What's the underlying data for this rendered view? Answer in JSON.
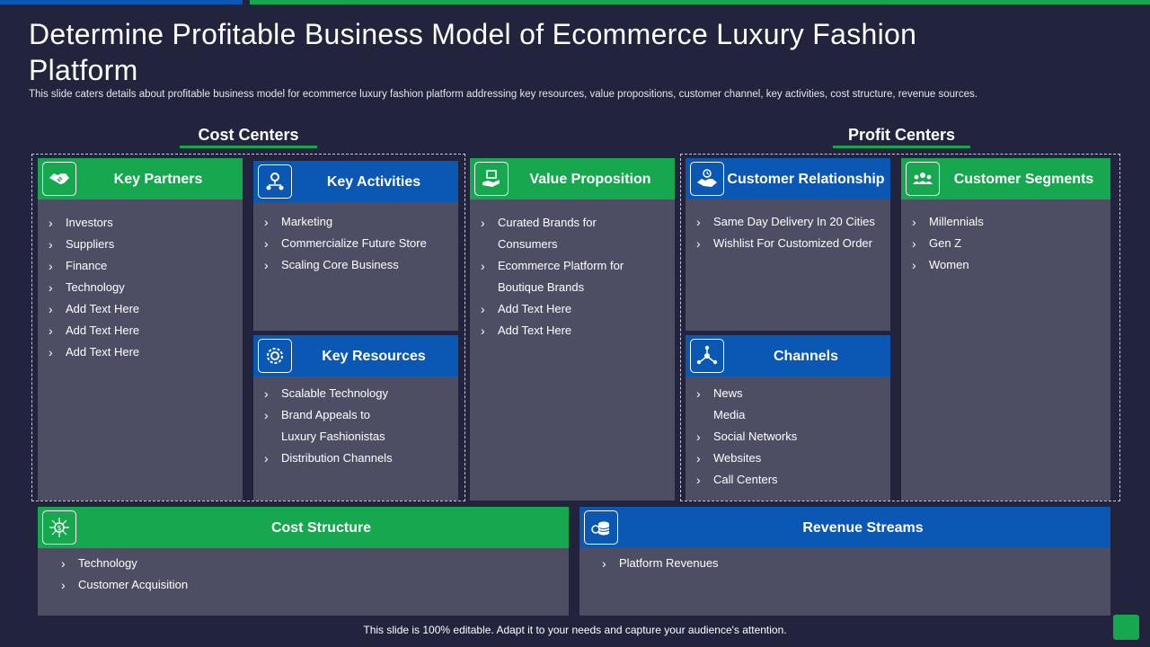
{
  "slide": {
    "title": "Determine Profitable Business Model of Ecommerce Luxury Fashion Platform",
    "subtitle": "This slide caters details about profitable business model for ecommerce luxury fashion platform addressing key resources, value propositions, customer channel, key activities, cost structure, revenue sources.",
    "footer": "This slide is 100% editable. Adapt it to your needs and capture your audience's attention."
  },
  "sections": {
    "cost_centers": "Cost Centers",
    "profit_centers": "Profit Centers"
  },
  "colors": {
    "background": "#21243c",
    "green": "#17a74f",
    "blue": "#0b57b4",
    "card": "#4d4e63"
  },
  "cards": {
    "key_partners": {
      "title": "Key Partners",
      "icon": "handshake-icon",
      "items": [
        "Investors",
        "Suppliers",
        "Finance",
        "Technology",
        "Add Text Here",
        "Add Text Here",
        "Add Text Here"
      ]
    },
    "key_activities": {
      "title": "Key Activities",
      "icon": "gear-network-icon",
      "items": [
        "Marketing",
        "Commercialize Future Store",
        "Scaling Core Business"
      ]
    },
    "key_resources": {
      "title": "Key Resources",
      "icon": "gear-icon",
      "items": [
        "Scalable Technology",
        "Brand Appeals to",
        "Luxury Fashionistas",
        "Distribution Channels"
      ]
    },
    "value_proposition": {
      "title": "Value Proposition",
      "icon": "hand-money-icon",
      "items": [
        "Curated Brands for",
        "Consumers",
        "Ecommerce Platform for",
        "Boutique Brands",
        "Add Text Here",
        "Add Text Here"
      ]
    },
    "customer_relationship": {
      "title": "Customer Relationship",
      "icon": "handshake-clock-icon",
      "items": [
        "Same Day Delivery In 20 Cities",
        "Wishlist For Customized Order"
      ]
    },
    "channels": {
      "title": "Channels",
      "icon": "network-nodes-icon",
      "items": [
        "News",
        "Media",
        "Social Networks",
        "Websites",
        "Call Centers"
      ]
    },
    "customer_segments": {
      "title": "Customer Segments",
      "icon": "users-group-icon",
      "items": [
        "Millennials",
        "Gen Z",
        "Women"
      ]
    },
    "cost_structure": {
      "title": "Cost Structure",
      "icon": "dollar-network-icon",
      "items": [
        "Technology",
        "Customer Acquisition"
      ]
    },
    "revenue_streams": {
      "title": "Revenue Streams",
      "icon": "coins-icon",
      "items": [
        "Platform Revenues"
      ]
    }
  }
}
